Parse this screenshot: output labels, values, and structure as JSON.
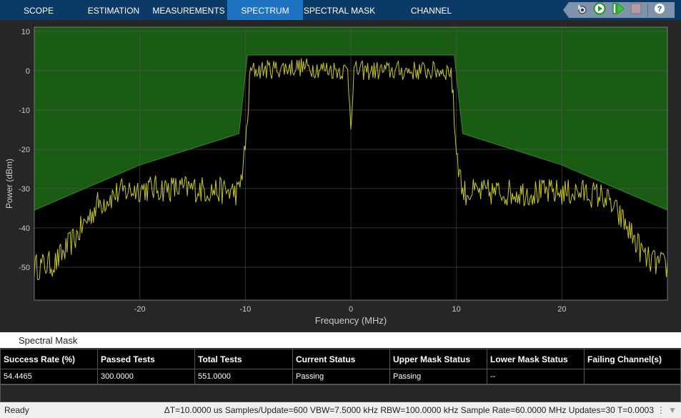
{
  "tabs": [
    {
      "label": "SCOPE"
    },
    {
      "label": "ESTIMATION"
    },
    {
      "label": "MEASUREMENTS"
    },
    {
      "label": "SPECTRUM",
      "active": true
    },
    {
      "label": "SPECTRAL MASK"
    },
    {
      "label": "CHANNEL MEASUREMENTS"
    }
  ],
  "toolbar": {
    "icons": [
      "settings-icon",
      "run-icon",
      "step-forward-icon",
      "stop-icon",
      "help-icon"
    ],
    "help_label": "?"
  },
  "chart_data": {
    "type": "line",
    "xlabel": "Frequency (MHz)",
    "ylabel": "Power (dBm)",
    "xlim": [
      -30,
      30
    ],
    "ylim": [
      -58.4,
      11.1
    ],
    "xticks": [
      -20,
      -10,
      0,
      10,
      20
    ],
    "yticks": [
      10,
      0,
      -10,
      -20,
      -30,
      -40,
      -50
    ],
    "grid": true,
    "colors": {
      "background": "#000000",
      "mask_fill": "#1a5c14",
      "mask_edge": "#2f8a25",
      "trace": "#c8c81e",
      "grid": "#4a4a4a"
    },
    "mask": {
      "x": [
        -30,
        -20,
        -10.6,
        -9.8,
        9.8,
        10.6,
        20,
        30
      ],
      "y": [
        -35.5,
        -24,
        -16,
        4,
        4,
        -16,
        -24,
        -35.5
      ]
    },
    "trace_envelope": {
      "x": [
        -30,
        -28,
        -26,
        -24,
        -22,
        -20,
        -15,
        -10.6,
        -10,
        -9.5,
        -5,
        -0.3,
        0,
        0.3,
        5,
        9.5,
        10,
        10.6,
        15,
        20,
        22,
        24,
        26,
        28,
        30
      ],
      "y": [
        -50,
        -49,
        -42,
        -34,
        -31,
        -30,
        -30,
        -31,
        -20,
        0,
        1,
        0,
        -13,
        0,
        0,
        0,
        -20,
        -31,
        -31,
        -31,
        -31,
        -32,
        -39,
        -48,
        -50
      ]
    }
  },
  "panel": {
    "title": "Spectral Mask"
  },
  "table": {
    "headers": [
      "Success Rate (%)",
      "Passed Tests",
      "Total Tests",
      "Current Status",
      "Upper Mask Status",
      "Lower Mask Status",
      "Failing Channel(s)"
    ],
    "rows": [
      [
        "54.4465",
        "300.0000",
        "551.0000",
        "Passing",
        "Passing",
        "--",
        ""
      ]
    ]
  },
  "status": {
    "ready": "Ready",
    "info": "ΔT=10.0000 us  Samples/Update=600  VBW=7.5000 kHz  RBW=100.0000 kHz  Sample Rate=60.0000 MHz  Updates=30  T=0.0003"
  }
}
